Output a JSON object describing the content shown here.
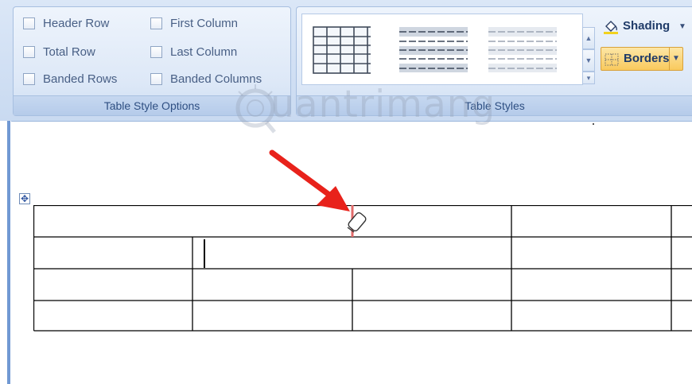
{
  "ribbon": {
    "table_style_options": {
      "caption": "Table Style Options",
      "options": {
        "header_row": "Header Row",
        "total_row": "Total Row",
        "banded_rows": "Banded Rows",
        "first_column": "First Column",
        "last_column": "Last Column",
        "banded_columns": "Banded Columns"
      }
    },
    "table_styles": {
      "caption": "Table Styles",
      "shading_label": "Shading",
      "borders_label": "Borders"
    }
  },
  "watermark": "uantrimang",
  "document": {
    "table": {
      "rows": 4,
      "cursor_in_cell": "row 2, column 2"
    }
  },
  "colors": {
    "accent": "#2e4f82",
    "annotation_arrow": "#e8221b",
    "borders_button": "#f9c95d"
  }
}
